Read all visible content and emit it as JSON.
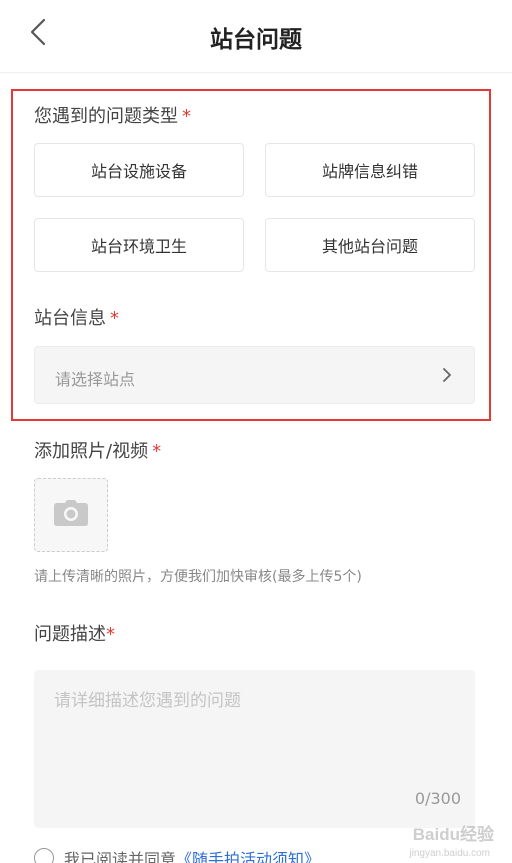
{
  "header": {
    "title": "站台问题",
    "back_icon": "chevron-left-icon"
  },
  "problem_type": {
    "label": "您遇到的问题类型",
    "required_mark": "*",
    "options": [
      "站台设施设备",
      "站牌信息纠错",
      "站台环境卫生",
      "其他站台问题"
    ]
  },
  "station_info": {
    "label": "站台信息",
    "required_mark": "*",
    "placeholder": "请选择站点",
    "chevron_icon": "chevron-right-icon"
  },
  "photo": {
    "label": "添加照片/视频",
    "required_mark": "*",
    "add_icon": "camera-icon",
    "hint": "请上传清晰的照片，方便我们加快审核(最多上传5个)"
  },
  "description": {
    "label": "问题描述",
    "required_mark": "*",
    "placeholder": "请详细描述您遇到的问题",
    "counter": "0/300"
  },
  "agreement": {
    "prefix": "我已阅读并同意",
    "link": "《随手拍活动须知》"
  },
  "watermark": {
    "text": "Baidu经验",
    "sub": "jingyan.baidu.com"
  },
  "colors": {
    "required": "#e53935",
    "highlight_border": "#e53935",
    "link": "#2d6fd6"
  }
}
